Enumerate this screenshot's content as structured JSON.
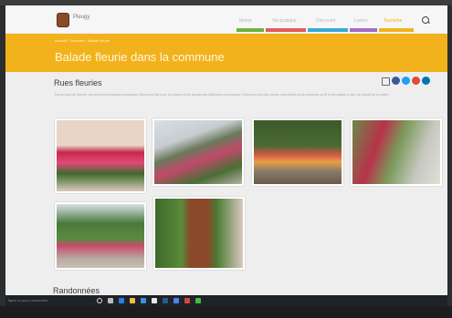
{
  "window": {
    "site_name": "Pleugy",
    "nav": [
      {
        "label": "Mairie",
        "color": "#6db23f"
      },
      {
        "label": "Vie pratique",
        "color": "#e45b5b"
      },
      {
        "label": "Découvrir",
        "color": "#37a9d6"
      },
      {
        "label": "Loisirs",
        "color": "#a36bc2"
      },
      {
        "label": "Tourisme",
        "color": "#f2b21c"
      }
    ],
    "active_nav": "Tourisme"
  },
  "banner": {
    "breadcrumb": "Accueil / Tourisme / Balade fleurie",
    "title": "Balade fleurie dans la commune"
  },
  "section": {
    "title": "Rues fleuries",
    "intro": "Tout au long de l'année, les services techniques municipaux fleurissent les rues, les places et les abords des bâtiments communaux. Découvrez les plus beaux coins fleuris de la commune au fil d'une balade à pied, au départ de la mairie."
  },
  "share_buttons": [
    {
      "name": "facebook",
      "color": "#3b5998"
    },
    {
      "name": "twitter",
      "color": "#1da1f2"
    },
    {
      "name": "google-plus",
      "color": "#dd4b39"
    },
    {
      "name": "linkedin",
      "color": "#0077b5"
    }
  ],
  "photos": [
    {
      "name": "window-box-flowers",
      "colors": [
        "#e7d6c8",
        "#c7284a",
        "#3f6a2b"
      ]
    },
    {
      "name": "house-garden-hydrangea",
      "colors": [
        "#d7e0e6",
        "#c04a6a",
        "#4a6e35"
      ]
    },
    {
      "name": "stone-wall-garden",
      "colors": [
        "#3c5a2a",
        "#d85a4a",
        "#8a7a6a"
      ]
    },
    {
      "name": "street-flowers",
      "colors": [
        "#6a8a4a",
        "#b8324a",
        "#c8c8c0"
      ]
    },
    {
      "name": "road-hedge-flowers",
      "colors": [
        "#4a7a3a",
        "#b8a8a0",
        "#d8e0e8"
      ]
    },
    {
      "name": "rusted-metal-sculpture",
      "colors": [
        "#3f6a2b",
        "#8a4a2a",
        "#d8c8c0"
      ]
    }
  ],
  "next_section": "Randonnées",
  "taskbar": {
    "search_text": "Taper ici pour rechercher"
  }
}
